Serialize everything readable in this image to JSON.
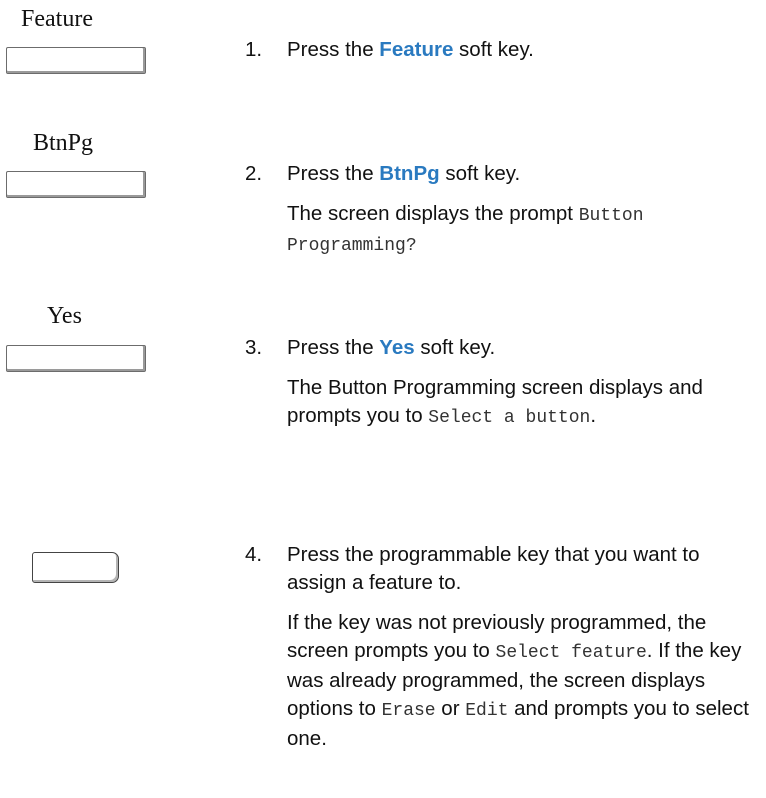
{
  "keys": {
    "feature": "Feature",
    "btnpg": "BtnPg",
    "yes": "Yes"
  },
  "steps": [
    {
      "number": "1.",
      "pre": "Press the ",
      "softkey": "Feature",
      "post": " soft key."
    },
    {
      "number": "2.",
      "pre": "Press the ",
      "softkey": "BtnPg",
      "post": " soft key.",
      "note_pre": "The screen displays the prompt ",
      "note_code": "Button Programming?"
    },
    {
      "number": "3.",
      "pre": "Press the ",
      "softkey": "Yes",
      "post": " soft key.",
      "note_pre": "The Button Programming screen displays and prompts you to ",
      "note_code": "Select a button",
      "note_post": "."
    },
    {
      "number": "4.",
      "text": "Press the programmable key that you want to assign a feature to.",
      "note_pre": "If the key was not previously programmed, the screen prompts you to ",
      "note_code1": "Select feature",
      "note_mid": ". If the key was already programmed, the screen displays options to ",
      "note_code2": "Erase",
      "note_or": " or ",
      "note_code3": "Edit",
      "note_post": " and prompts you to select one."
    }
  ]
}
